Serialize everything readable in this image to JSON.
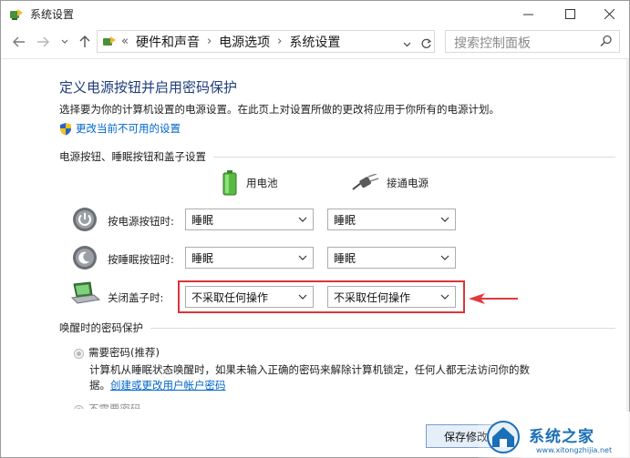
{
  "window": {
    "title": "系统设置"
  },
  "breadcrumb": [
    "硬件和声音",
    "电源选项",
    "系统设置"
  ],
  "search": {
    "placeholder": "搜索控制面板"
  },
  "main": {
    "heading": "定义电源按钮并启用密码保护",
    "description": "选择要为你的计算机设置的电源设置。在此页上对设置所做的更改将应用于你所有的电源计划。",
    "change_settings_link": "更改当前不可用的设置",
    "buttons_section": "电源按钮、睡眠按钮和盖子设置",
    "columns": {
      "battery": "用电池",
      "plugged": "接通电源"
    },
    "rows": [
      {
        "label": "按电源按钮时:",
        "battery": "睡眠",
        "plugged": "睡眠"
      },
      {
        "label": "按睡眠按钮时:",
        "battery": "睡眠",
        "plugged": "睡眠"
      },
      {
        "label": "关闭盖子时:",
        "battery": "不采取任何操作",
        "plugged": "不采取任何操作"
      }
    ],
    "wake_section": "唤醒时的密码保护",
    "require_password": "需要密码(推荐)",
    "require_desc_line1": "计算机从睡眠状态唤醒时，如果未输入正确的密码来解除计算机锁定，任何人都无法访问你的数",
    "require_desc_line2_prefix": "据。",
    "create_password_link": "创建或更改用户帐户密码",
    "no_password": "不需要密码",
    "save_button": "保存修改"
  },
  "watermark": {
    "text": "系统之家",
    "sub": "www.xitongzhijia.net"
  },
  "colors": {
    "heading": "#1e3d7b",
    "link": "#0066cc",
    "highlight": "#d9353a"
  }
}
